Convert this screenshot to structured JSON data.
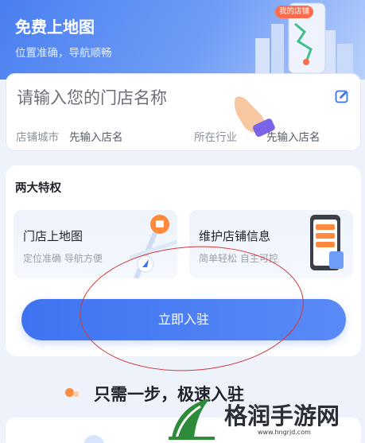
{
  "hero": {
    "title": "免费上地图",
    "subtitle": "位置准确，导航顺畅",
    "tag": "我的店铺"
  },
  "store_form": {
    "name_placeholder": "请输入您的门店名称",
    "city_label": "店铺城市",
    "city_value": "先输入店名",
    "industry_label": "所在行业",
    "industry_value": "先输入店名"
  },
  "privileges": {
    "title": "两大特权",
    "items": [
      {
        "title": "门店上地图",
        "subtitle": "定位准确 导航方便"
      },
      {
        "title": "维护店铺信息",
        "subtitle": "简单轻松 自主可控"
      }
    ],
    "cta_label": "立即入驻"
  },
  "steps": {
    "title": "只需一步，极速入驻"
  },
  "watermark": {
    "name": "格润手游网",
    "url": "www.hngrjd.com"
  },
  "colors": {
    "primary": "#3e74f2",
    "annotation": "#d23838",
    "accent_orange": "#ff8a3d"
  },
  "icons": [
    "edit-icon",
    "pointing-hand-icon",
    "map-pin-icon",
    "navigation-arrow-icon",
    "phone-store-icon",
    "watermark-logo-icon"
  ]
}
